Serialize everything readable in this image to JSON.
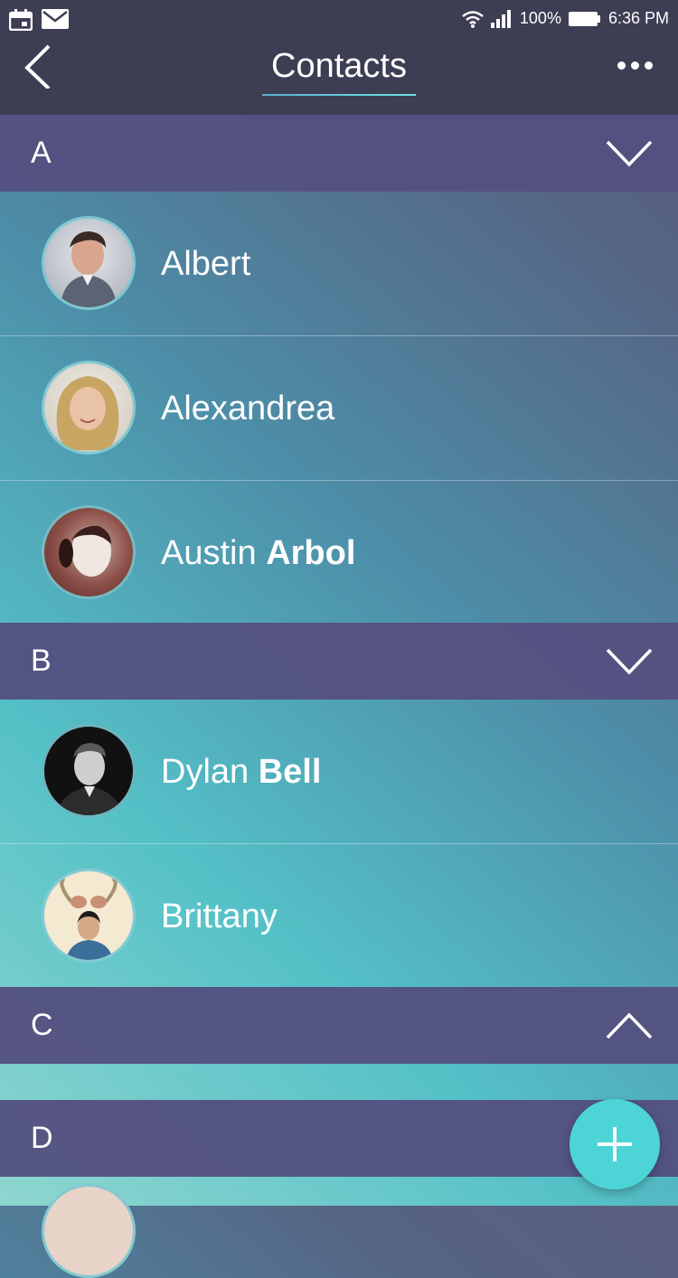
{
  "status_bar": {
    "battery": "100%",
    "time": "6:36 PM"
  },
  "header": {
    "title": "Contacts"
  },
  "sections": [
    {
      "letter": "A",
      "expanded": true,
      "contacts": [
        {
          "first": "Albert",
          "last": ""
        },
        {
          "first": "Alexandrea",
          "last": ""
        },
        {
          "first": "Austin",
          "last": "Arbol"
        }
      ]
    },
    {
      "letter": "B",
      "expanded": true,
      "contacts": [
        {
          "first": "Dylan",
          "last": "Bell"
        },
        {
          "first": "Brittany",
          "last": ""
        }
      ]
    },
    {
      "letter": "C",
      "expanded": false,
      "contacts": []
    },
    {
      "letter": "D",
      "expanded": true,
      "contacts": []
    }
  ],
  "colors": {
    "header_bg": "#3d3d53",
    "section_bg": "#545080",
    "accent": "#4dd4d6"
  },
  "icons": {
    "back": "chevron-left-icon",
    "more": "more-dots-icon",
    "add": "plus-icon"
  }
}
